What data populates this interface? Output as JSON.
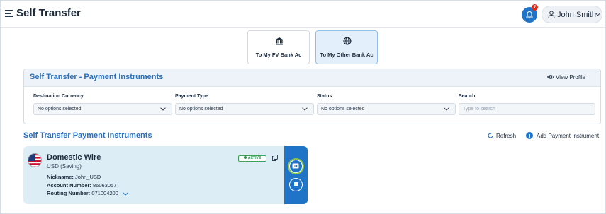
{
  "header": {
    "title": "Self Transfer",
    "notification_count": "7",
    "user_name": "John Smith"
  },
  "destination_tabs": [
    {
      "label": "To My FV Bank Ac",
      "icon": "bank-icon",
      "selected": false
    },
    {
      "label": "To My Other Bank Ac",
      "icon": "globe-icon",
      "selected": true
    }
  ],
  "filters_panel": {
    "title": "Self Transfer - Payment Instruments",
    "view_profile_label": "View Profile",
    "filters": [
      {
        "label": "Destination Currency",
        "value": "No options selected"
      },
      {
        "label": "Payment Type",
        "value": "No options selected"
      },
      {
        "label": "Status",
        "value": "No options selected"
      }
    ],
    "search": {
      "label": "Search",
      "placeholder": "Type to search"
    }
  },
  "section": {
    "title": "Self Transfer Payment Instruments",
    "refresh_label": "Refresh",
    "add_label": "Add Payment Instrument"
  },
  "instrument": {
    "title": "Domestic Wire",
    "subtitle": "USD (Saving)",
    "status": "ACTIVE",
    "nickname_label": "Nickname:",
    "nickname_value": "John_USD",
    "account_label": "Account Number:",
    "account_value": "86063057",
    "routing_label": "Routing Number:",
    "routing_value": "071004200"
  },
  "colors": {
    "accent": "#1f74c8",
    "title_blue": "#2a70bd",
    "card_bg": "#dcedf6",
    "badge_red": "#d92d20",
    "active_green": "#2d8a4b"
  }
}
